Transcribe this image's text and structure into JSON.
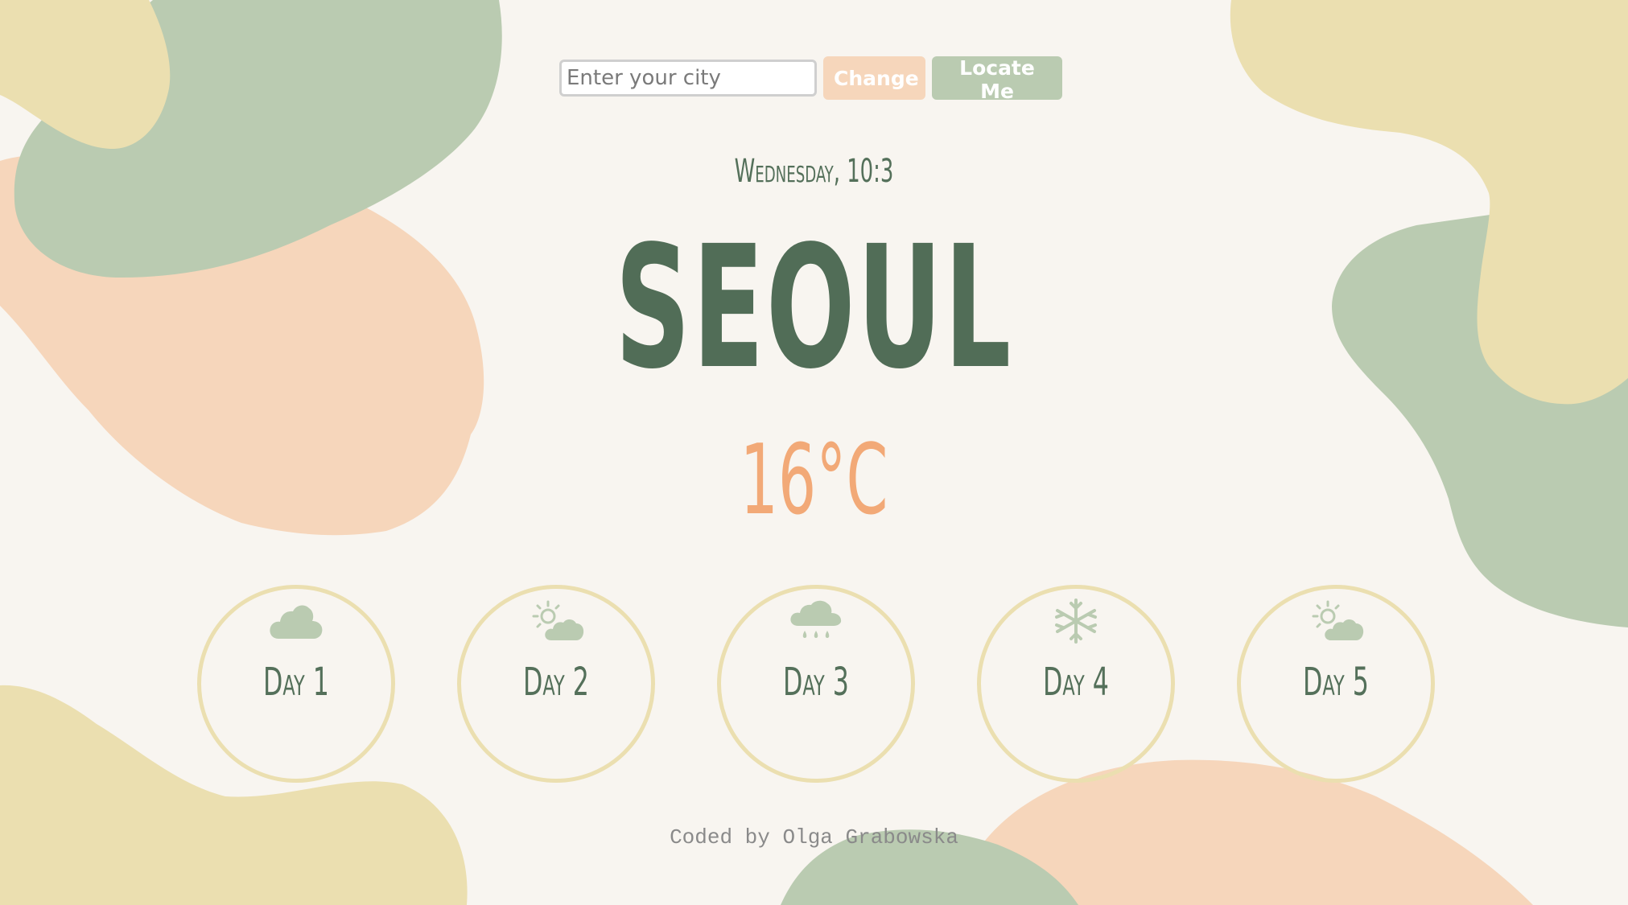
{
  "search": {
    "placeholder": "Enter your city",
    "value": ""
  },
  "buttons": {
    "change_label": "Change",
    "locate_label": "Locate Me"
  },
  "weather": {
    "date_time": "Wednesday, 10:3",
    "city": "Seoul",
    "temperature": "16°C"
  },
  "forecast": [
    {
      "label": "Day 1",
      "icon": "cloud-icon"
    },
    {
      "label": "Day 2",
      "icon": "partly-sunny-icon"
    },
    {
      "label": "Day 3",
      "icon": "rain-cloud-icon"
    },
    {
      "label": "Day 4",
      "icon": "snowflake-icon"
    },
    {
      "label": "Day 5",
      "icon": "partly-sunny-icon"
    }
  ],
  "footer": {
    "credit": "Coded by Olga Grabowska"
  },
  "colors": {
    "background": "#f8f5f0",
    "sage": "#bacbb1",
    "peach": "#f6d6bb",
    "sand": "#ebdfb0",
    "dark_green": "#516d57",
    "orange": "#f2a977"
  }
}
